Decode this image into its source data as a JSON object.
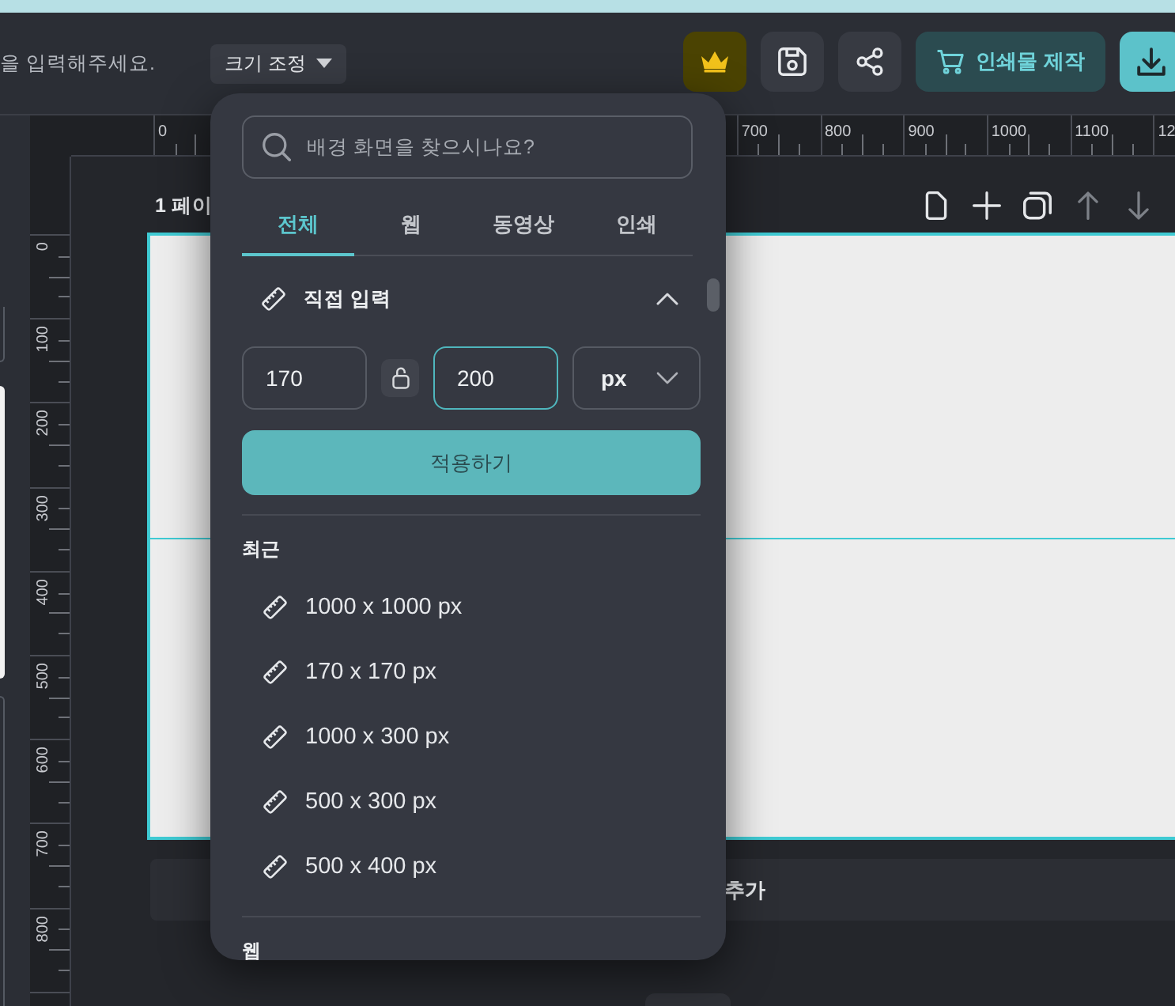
{
  "header": {
    "title_field": {
      "placeholder": "을 입력해주세요."
    },
    "resize_button": {
      "label": "크기 조정"
    },
    "actions": [
      {
        "kind": "premium"
      },
      {
        "kind": "save"
      },
      {
        "kind": "share"
      },
      {
        "kind": "print",
        "label": "인쇄물 제작"
      },
      {
        "kind": "download"
      }
    ]
  },
  "rulers": {
    "top": {
      "start_labels": [
        "0"
      ],
      "end_labels": [
        "700",
        "800",
        "900",
        "1000",
        "1100",
        "12"
      ]
    },
    "left": {
      "labels": [
        "0",
        "100",
        "200",
        "300",
        "400",
        "500",
        "600",
        "700",
        "800"
      ]
    }
  },
  "page_toolbar": {
    "title": "1 페이",
    "actions": [
      {
        "kind": "page",
        "disabled": false
      },
      {
        "kind": "add",
        "disabled": false
      },
      {
        "kind": "duplicate",
        "disabled": false
      },
      {
        "kind": "move_up",
        "disabled": true
      },
      {
        "kind": "move_down",
        "disabled": true
      }
    ]
  },
  "add_page_bar": {
    "label": "추가"
  },
  "resize_panel": {
    "search": {
      "placeholder": "배경 화면을 찾으시나요?"
    },
    "tabs": [
      {
        "label": "전체",
        "selected": true
      },
      {
        "label": "웹",
        "selected": false
      },
      {
        "label": "동영상",
        "selected": false
      },
      {
        "label": "인쇄",
        "selected": false
      }
    ],
    "custom_size": {
      "title": "직접 입력",
      "expanded": true,
      "width": {
        "value": "170",
        "focused": false
      },
      "height": {
        "value": "200",
        "focused": true
      },
      "ratio_locked": false,
      "unit": "px",
      "apply_label": "적용하기"
    },
    "recent": {
      "title": "최근",
      "items": [
        {
          "label": "1000 x 1000 px"
        },
        {
          "label": "170 x 170 px"
        },
        {
          "label": "1000 x 300 px"
        },
        {
          "label": "500 x 300 px"
        },
        {
          "label": "500 x 400 px"
        }
      ]
    },
    "next_section": {
      "title": "웹"
    }
  }
}
